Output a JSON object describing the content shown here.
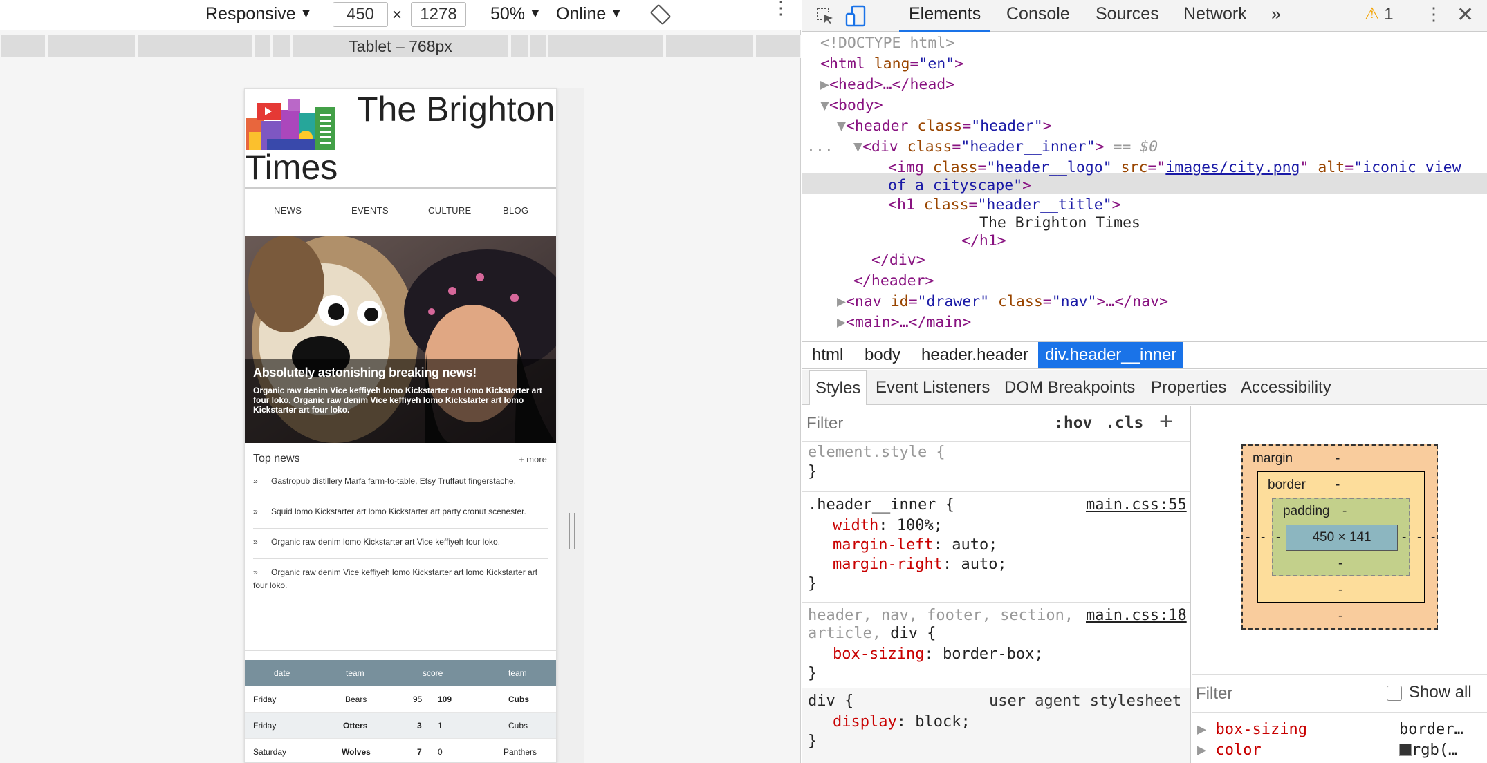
{
  "device_toolbar": {
    "device": "Responsive",
    "width": "450",
    "times": "×",
    "height": "1278",
    "zoom": "50%",
    "throttle": "Online",
    "media_query_label": "Tablet – 768px"
  },
  "site": {
    "title_line1": "The Brighton",
    "title_line2": "Times",
    "nav": [
      "NEWS",
      "EVENTS",
      "CULTURE",
      "BLOG"
    ],
    "hero_title": "Absolutely astonishing breaking news!",
    "hero_text": "Organic raw denim Vice keffiyeh lomo Kickstarter art lomo Kickstarter art four loko. Organic raw denim Vice keffiyeh lomo Kickstarter art lomo Kickstarter art four loko.",
    "top_news_title": "Top news",
    "top_news_more": "+ more",
    "bullet": "»",
    "top_news": [
      "Gastropub distillery Marfa farm-to-table, Etsy Truffaut fingerstache.",
      "Squid lomo Kickstarter art lomo Kickstarter art party cronut scenester.",
      "Organic raw denim lomo Kickstarter art Vice keffiyeh four loko.",
      "Organic raw denim Vice keffiyeh lomo Kickstarter art lomo Kickstarter art four loko."
    ],
    "table_headers": [
      "date",
      "team",
      "score",
      "team"
    ],
    "table_rows": [
      {
        "date": "Friday",
        "team1": "Bears",
        "s1": "95",
        "s2": "109",
        "team2": "Cubs"
      },
      {
        "date": "Friday",
        "team1": "Otters",
        "s1": "3",
        "s2": "1",
        "team2": "Cubs"
      },
      {
        "date": "Saturday",
        "team1": "Wolves",
        "s1": "7",
        "s2": "0",
        "team2": "Panthers"
      }
    ]
  },
  "devtools": {
    "tabs": [
      "Elements",
      "Console",
      "Sources",
      "Network",
      "»"
    ],
    "warning_count": "1",
    "dom": {
      "doctype": "<!DOCTYPE html>",
      "html_open": "<html",
      "lang_attr": "lang",
      "lang_val": "\"en\"",
      "head": "<head>…</head>",
      "body_open": "<body>",
      "header_open": "<header",
      "class_attr": "class",
      "header_class_val": "\"header\"",
      "div_open": "<div",
      "div_class_val": "\"header__inner\"",
      "selected_marker": "== $0",
      "img_open": "<img",
      "img_class_val": "\"header__logo\"",
      "src_attr": "src",
      "src_val": "images/city.png",
      "alt_attr": "alt",
      "alt_val_1": "\"iconic view",
      "alt_val_2": "of a cityscape\"",
      "h1_open": "<h1",
      "h1_class_val": "\"header__title\"",
      "h1_text": "The Brighton Times",
      "h1_close": "</h1>",
      "div_close": "</div>",
      "header_close": "</header>",
      "nav_open": "<nav",
      "id_attr": "id",
      "nav_id_val": "\"drawer\"",
      "nav_class_val": "\"nav\"",
      "nav_close": ">…</nav>",
      "main": "<main>…</main>",
      "ellipsis": "..."
    },
    "breadcrumbs": [
      "html",
      "body",
      "header.header",
      "div.header__inner"
    ],
    "subtabs": [
      "Styles",
      "Event Listeners",
      "DOM Breakpoints",
      "Properties",
      "Accessibility"
    ],
    "styles_filter_placeholder": "Filter",
    "hov": ":hov",
    "cls": ".cls",
    "plus": "+",
    "rules": {
      "element_style": "element.style {",
      "close": "}",
      "r1_selector": ".header__inner {",
      "r1_source": "main.css:55",
      "r1_props": [
        {
          "name": "width",
          "value": "100%;"
        },
        {
          "name": "margin-left",
          "value": "auto;"
        },
        {
          "name": "margin-right",
          "value": "auto;"
        }
      ],
      "r2_selector_1": "header, nav, footer, section,",
      "r2_selector_2": "article, div {",
      "r2_source": "main.css:18",
      "r2_props": [
        {
          "name": "box-sizing",
          "value": "border-box;"
        }
      ],
      "r3_selector": "div {",
      "r3_source": "user agent stylesheet",
      "r3_props": [
        {
          "name": "display",
          "value": "block;"
        }
      ]
    },
    "box_model": {
      "margin_label": "margin",
      "border_label": "border",
      "padding_label": "padding",
      "dash": "-",
      "content": "450 × 141"
    },
    "computed_filter_placeholder": "Filter",
    "show_all": "Show all",
    "computed": [
      {
        "name": "box-sizing",
        "value": "border…"
      },
      {
        "name": "color",
        "value": "rgb(…"
      }
    ]
  }
}
